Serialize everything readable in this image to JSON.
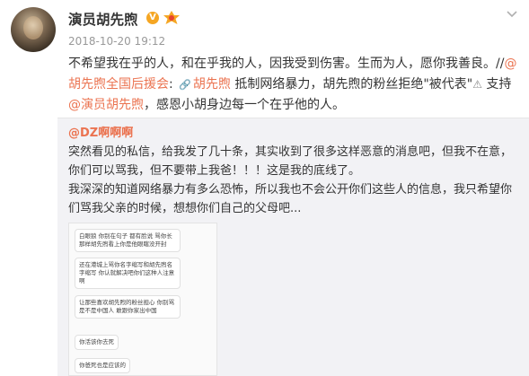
{
  "post": {
    "username": "演员胡先煦",
    "verified_icon": "verified-v-icon",
    "badge_icon": "member-badge-icon",
    "menu_icon": "chevron-down-icon",
    "timestamp": "2018-10-20 19:12",
    "text_part1": "不希望我在乎的人，和在乎我的人，因我受到伤害。生而为人，愿你我善良。//",
    "mention1": "@胡先煦全国后援会",
    "text_part2": ":",
    "link_text": "胡先煦",
    "text_part3": " 抵制网络暴力，胡先煦的粉丝拒绝\"被代表\"",
    "warn_glyph": "⚠",
    "text_part4": " 支持",
    "mention2": "@演员胡先煦",
    "text_part5": "，感恩小胡身边每一个在乎他的人。"
  },
  "repost": {
    "author": "@DZ啊啊啊",
    "paragraph1": "突然看见的私信，给我发了几十条，其实收到了很多这样恶意的消息吧，但我不在意，你们可以骂我，但不要带上我爸！！！这是我的底线了。",
    "paragraph2": "我深深的知道网络暴力有多么恐怖，所以我也不会公开你们这些人的信息，我只希望你们骂我父亲的时候，想想你们自己的父母吧...",
    "screenshot_messages": [
      "白眼狼 你别在句子 都有脸说 骂你长那样胡先煦看上你是他眼瞎没开封",
      "还在港城上骂你名字缩写和胡先煦名字缩写 你认就解决吧你们这种人注意啊",
      "让那些喜欢胡先煦的粉丝担心 你别骂是不是中国人 敢跟你家出中国",
      "你活该你去死",
      "你爸死也是应该的"
    ]
  }
}
